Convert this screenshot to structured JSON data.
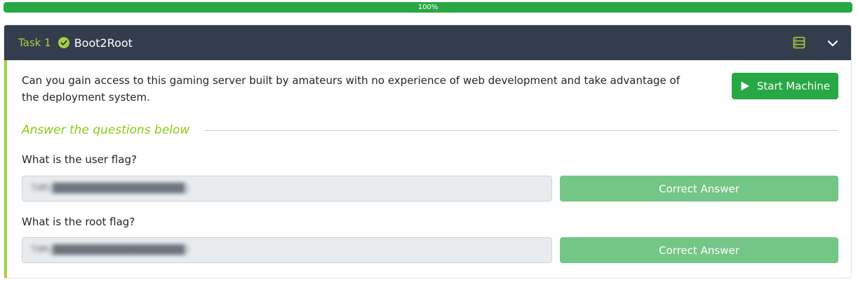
{
  "progress": {
    "label": "100%",
    "value": 100
  },
  "task": {
    "number_label": "Task 1",
    "title": "Boot2Root",
    "description": "Can you gain access to this gaming server built by amateurs with no experience of web development and take advantage of the deployment system.",
    "start_button_label": "Start Machine",
    "section_heading": "Answer the questions below",
    "questions": [
      {
        "label": "What is the user flag?",
        "answer_value": "THM{████████████████████████}",
        "button_label": "Correct Answer"
      },
      {
        "label": "What is the root flag?",
        "answer_value": "THM{████████████████████████}",
        "button_label": "Correct Answer"
      }
    ]
  },
  "colors": {
    "progress_green": "#28a745",
    "header_bg": "#343d4d",
    "accent_lime": "#a3d140",
    "correct_button": "#74c687"
  },
  "icons": {
    "completed": "check-circle-icon",
    "machine": "server-icon",
    "toggle": "chevron-down-icon",
    "start": "play-icon"
  }
}
